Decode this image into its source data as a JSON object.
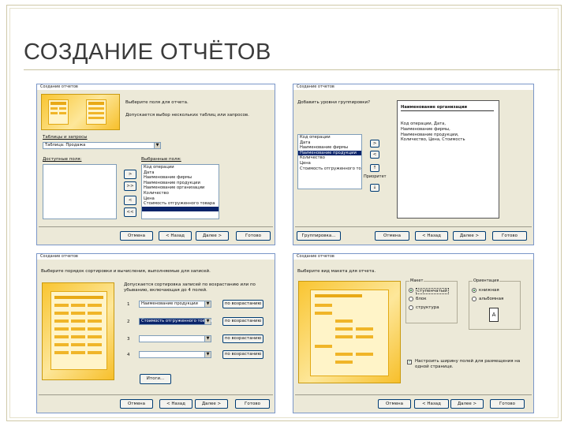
{
  "slide": {
    "title": "СОЗДАНИЕ ОТЧЁТОВ"
  },
  "win1": {
    "titlebar": "Создание отчетов",
    "prompt": "Выберите поля для отчета.",
    "hint": "Допускается выбор нескольких таблиц или запросов.",
    "tables_label": "Таблицы и запросы",
    "table_value": "Таблица: Продажа",
    "available_label": "Доступные поля:",
    "selected_label": "Выбранные поля:",
    "selected_fields": [
      "Код операции",
      "Дата",
      "Наименование фирмы",
      "Наименование продукции",
      "Наименование организации",
      "Количество",
      "Цена",
      "Стоимость отгруженного товара"
    ],
    "move_buttons": [
      ">",
      ">>",
      "<",
      "<<"
    ],
    "cancel": "Отмена",
    "back": "< Назад",
    "next": "Далее >",
    "finish": "Готово"
  },
  "win2": {
    "titlebar": "Создание отчетов",
    "prompt": "Добавить уровни группировки?",
    "fields": [
      "Код операции",
      "Дата",
      "Наименование фирмы",
      "Наименование продукции",
      "Количество",
      "Цена",
      "Стоимость отгруженного товара"
    ],
    "preview_header": "Наименование организации",
    "preview_body": "Код операции, Дата, Наименование фирмы, Наименование продукции, Количество, Цена, Стоимость",
    "arrow_buttons": [
      ">",
      "<",
      "↑",
      "Приоритет",
      "↓"
    ],
    "grouping": "Группировка...",
    "cancel": "Отмена",
    "back": "< Назад",
    "next": "Далее >",
    "finish": "Готово"
  },
  "win3": {
    "titlebar": "Создание отчетов",
    "prompt": "Выберите порядок сортировки и вычисления, выполняемые для записей.",
    "hint": "Допускается сортировка записей по возрастанию или по убыванию, включающая до 4 полей.",
    "sort_fields": [
      "Наименование продукции",
      "Стоимость отгруженного товара",
      "",
      ""
    ],
    "sort_orders": [
      "по возрастанию",
      "по возрастанию",
      "по возрастанию",
      "по возрастанию"
    ],
    "row_numbers": [
      "1",
      "2",
      "3",
      "4"
    ],
    "totals": "Итоги...",
    "cancel": "Отмена",
    "back": "< Назад",
    "next": "Далее >",
    "finish": "Готово"
  },
  "win4": {
    "titlebar": "Создание отчетов",
    "prompt": "Выберите вид макета для отчета.",
    "layout_label": "Макет",
    "layout_options": [
      "ступенчатый",
      "блок",
      "структура"
    ],
    "orientation_label": "Ориентация",
    "orientation_options": [
      "книжная",
      "альбомная"
    ],
    "orientation_icon_letter": "A",
    "fit_checkbox": "Настроить ширину полей для размещения на одной странице.",
    "fit_mark": "✓",
    "cancel": "Отмена",
    "back": "< Назад",
    "next": "Далее >",
    "finish": "Готово"
  }
}
